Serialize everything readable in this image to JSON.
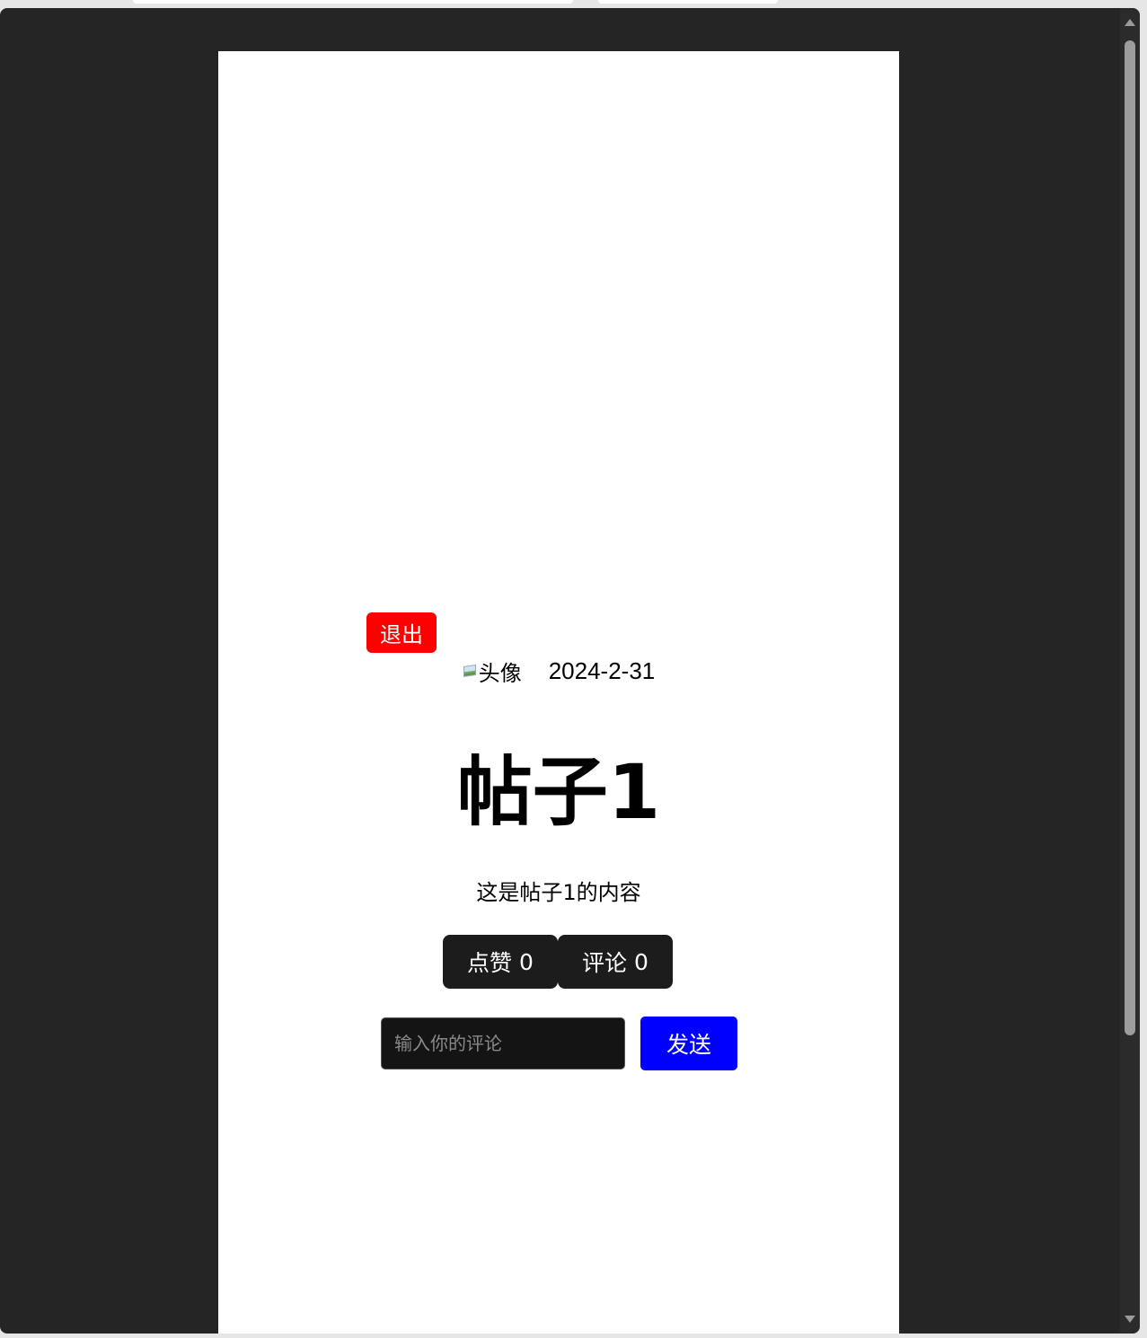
{
  "post": {
    "logout_label": "退出",
    "avatar_alt": "头像",
    "date": "2024-2-31",
    "title": "帖子1",
    "content": "这是帖子1的内容",
    "like_label": "点赞",
    "like_count": "0",
    "comment_label": "评论",
    "comment_count": "0",
    "comment_placeholder": "输入你的评论",
    "send_label": "发送"
  },
  "colors": {
    "logout": "#ff0000",
    "send": "#0000ff",
    "action_button": "#1c1c1c",
    "backdrop": "#252525"
  },
  "icons": {
    "avatar": "broken-image-icon"
  }
}
